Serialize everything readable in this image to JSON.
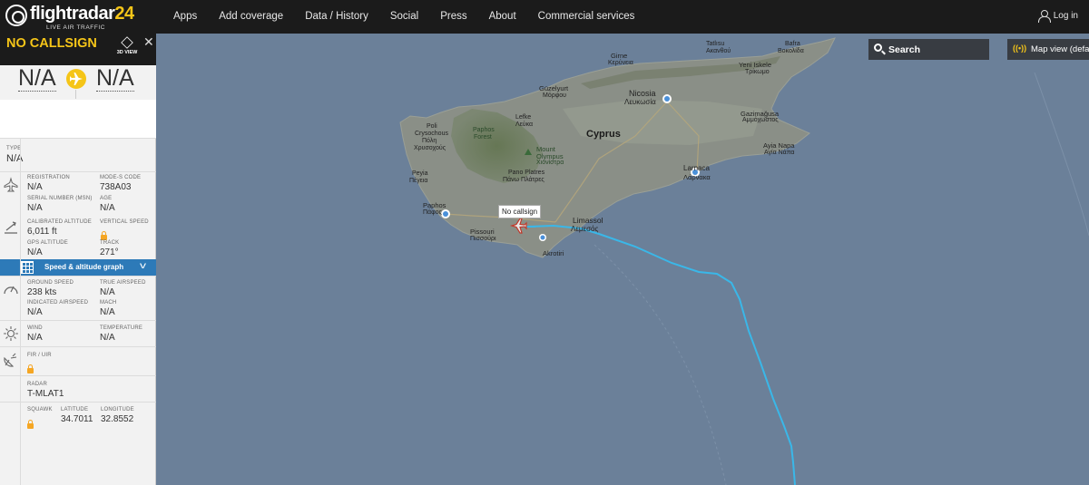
{
  "header": {
    "logo_text": "flightradar",
    "logo_num": "24",
    "logo_tagline": "LIVE AIR TRAFFIC",
    "nav": [
      "Apps",
      "Add coverage",
      "Data / History",
      "Social",
      "Press",
      "About",
      "Commercial services"
    ],
    "login": "Log in"
  },
  "panel": {
    "callsign": "NO CALLSIGN",
    "view3d_label": "3D VIEW",
    "close": "✕",
    "origin": "N/A",
    "destination": "N/A",
    "type_label": "TYPE",
    "type_value": "N/A",
    "registration_label": "REGISTRATION",
    "registration_value": "N/A",
    "modes_label": "MODE-S CODE",
    "modes_value": "738A03",
    "serial_label": "SERIAL NUMBER (MSN)",
    "serial_value": "N/A",
    "age_label": "AGE",
    "age_value": "N/A",
    "cal_alt_label": "CALIBRATED ALTITUDE",
    "cal_alt_value": "6,011 ft",
    "vspeed_label": "VERTICAL SPEED",
    "gps_alt_label": "GPS ALTITUDE",
    "gps_alt_value": "N/A",
    "track_label": "TRACK",
    "track_value": "271°",
    "graph_label": "Speed & altitude graph",
    "ground_speed_label": "GROUND SPEED",
    "ground_speed_value": "238 kts",
    "true_airspeed_label": "TRUE AIRSPEED",
    "true_airspeed_value": "N/A",
    "ias_label": "INDICATED AIRSPEED",
    "ias_value": "N/A",
    "mach_label": "MACH",
    "mach_value": "N/A",
    "wind_label": "WIND",
    "wind_value": "N/A",
    "temp_label": "TEMPERATURE",
    "temp_value": "N/A",
    "fir_label": "FIR / UIR",
    "radar_label": "RADAR",
    "radar_value": "T-MLAT1",
    "squawk_label": "SQUAWK",
    "lat_label": "LATITUDE",
    "lat_value": "34.7011",
    "lon_label": "LONGITUDE",
    "lon_value": "32.8552"
  },
  "map": {
    "search_label": "Search",
    "mapview_icon": "((•))",
    "mapview_label": "Map view (default)",
    "aircraft_label": "No callsign",
    "places": {
      "cyprus": "Cyprus",
      "nicosia": "Nicosia",
      "nicosia_gr": "Λευκωσία",
      "limassol": "Limassol",
      "limassol_gr": "Λεμεσός",
      "larnaca": "Larnaca",
      "larnaca_gr": "Λάρνακα",
      "paphos": "Paphos",
      "paphos_gr": "Πάφος",
      "akrotiri": "Akrotiri",
      "pissouri": "Pissouri",
      "pissouri_gr": "Πισσούρι",
      "polis": "Poli",
      "polis_gr": "Crysochous",
      "polis_gr2": "Πόλη",
      "polis_gr3": "Χρυσοχούς",
      "peyia": "Peyia",
      "peyia_gr": "Πέγεια",
      "guzelyurt": "Güzelyurt",
      "guzelyurt_gr": "Μόρφου",
      "lefka": "Lefke",
      "lefka_gr": "Λεύκα",
      "kyrenia": "Girne",
      "kyrenia_gr": "Κερύνεια",
      "olympus": "Mount",
      "olympus2": "Olympus",
      "olympus_gr": "Χιονίστρα",
      "pano": "Pano Platres",
      "pano_gr": "Πάνω Πλάτρες",
      "forest": "Paphos",
      "forest2": "Forest",
      "yeni": "Yeni Iskele",
      "yeni_gr": "Τρίκωμο",
      "bafra": "Bafra",
      "bafra_gr": "Βοκολίδα",
      "tatlisu": "Tatlısu",
      "tatlisu_gr": "Ακανθού",
      "gazi": "Gazimağusa",
      "gazi_gr": "Αμμόχωστος",
      "ayianapa": "Ayia Napa",
      "ayianapa_gr": "Αγία Νάπα"
    }
  },
  "colors": {
    "sea": "#6b8099",
    "land": "#8a8f87",
    "track": "#3ab7e8",
    "accent": "#f5c518",
    "lock": "#f5a623"
  }
}
